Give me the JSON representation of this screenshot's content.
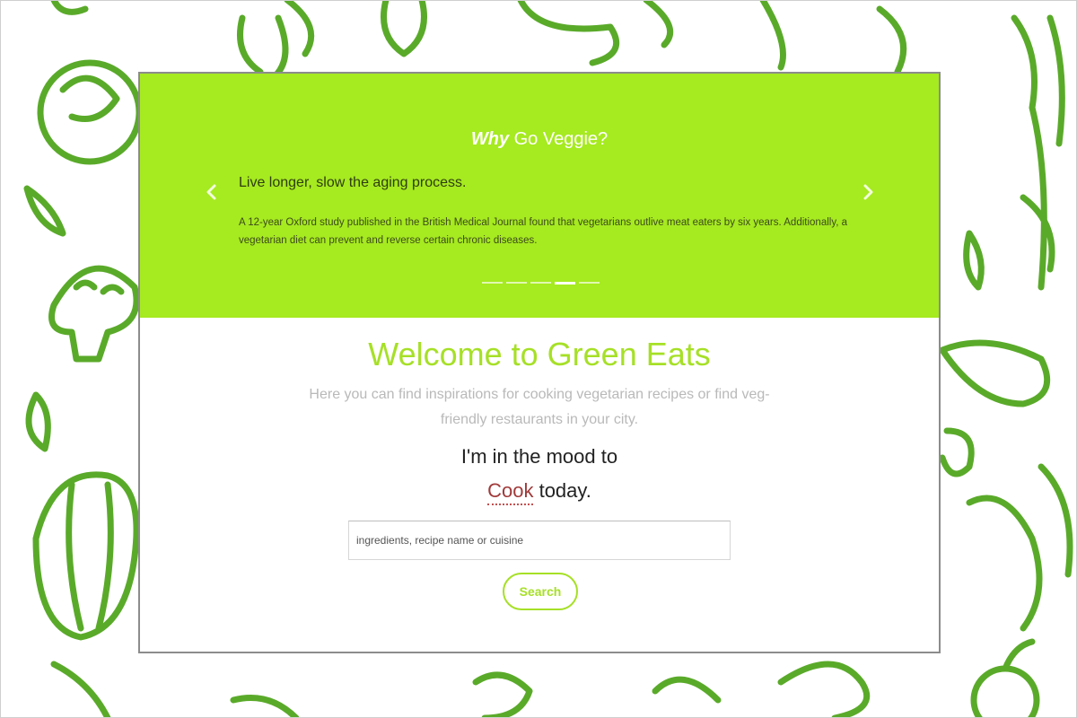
{
  "hero": {
    "title_emphasis": "Why",
    "title_rest": " Go Veggie?",
    "headline": "Live longer, slow the aging process.",
    "body": "A 12-year Oxford study published in the British Medical Journal found that vegetarians outlive meat eaters by six years. Additionally, a vegetarian diet can prevent and reverse certain chronic diseases.",
    "prev_icon": "chevron-left-icon",
    "next_icon": "chevron-right-icon",
    "slide_count": 5,
    "active_slide": 4
  },
  "welcome": {
    "title": "Welcome to Green Eats",
    "subtitle": "Here you can find inspirations for cooking vegetarian recipes or find veg-friendly restaurants in your city."
  },
  "mood": {
    "prefix": "I'm in the mood to",
    "choice": "Cook",
    "suffix": " today."
  },
  "search": {
    "placeholder": "ingredients, recipe name or cuisine",
    "button_label": "Search"
  },
  "colors": {
    "accent": "#a6ea20",
    "choice": "#a13a3a",
    "doodle": "#5aaa2a"
  }
}
